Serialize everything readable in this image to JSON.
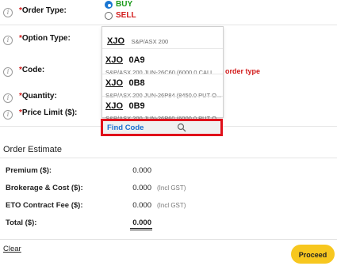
{
  "order_form": {
    "order_type": {
      "label": "Order Type:",
      "required_mark": "*",
      "options": [
        {
          "label": "BUY",
          "selected": true
        },
        {
          "label": "SELL",
          "selected": false
        }
      ]
    },
    "option_type": {
      "label": "Option Type:",
      "required_mark": "*"
    },
    "code": {
      "label": "Code:",
      "required_mark": "*",
      "error_text": "r order type"
    },
    "quantity": {
      "label": "Quantity:",
      "required_mark": "*"
    },
    "price_limit": {
      "label": "Price Limit ($):",
      "required_mark": "*"
    }
  },
  "dropdown": {
    "items": [
      {
        "code": "XJO",
        "desc": "S&P/ASX 200"
      },
      {
        "code": "XJO",
        "suffix": "0A9",
        "desc": "S&P/ASX 200 JUN-26C60 (6000.0 CALL..."
      },
      {
        "code": "XJO",
        "suffix": "0B8",
        "desc": "S&P/ASX 200 JUN-26P84 (8450.0 PUT O..."
      },
      {
        "code": "XJO",
        "suffix": "0B9",
        "desc": "S&P/ASX 200 JUN-26P60 (6000.0 PUT O..."
      }
    ],
    "find_code_label": "Find Code",
    "search_icon": "search-icon"
  },
  "order_estimate": {
    "title": "Order Estimate",
    "rows": [
      {
        "label": "Premium ($):",
        "value": "0.000",
        "note": ""
      },
      {
        "label": "Brokerage & Cost ($):",
        "value": "0.000",
        "note": "(Incl GST)"
      },
      {
        "label": "ETO Contract Fee ($):",
        "value": "0.000",
        "note": "(Incl GST)"
      },
      {
        "label": "Total ($):",
        "value": "0.000",
        "note": ""
      }
    ]
  },
  "actions": {
    "clear_label": "Clear",
    "proceed_label": "Proceed"
  },
  "colors": {
    "buy": "#1a9a1a",
    "sell": "#d21a1a",
    "link": "#1a6fd0",
    "highlight": "#e0101a",
    "proceed_bg": "#f7c71f"
  }
}
